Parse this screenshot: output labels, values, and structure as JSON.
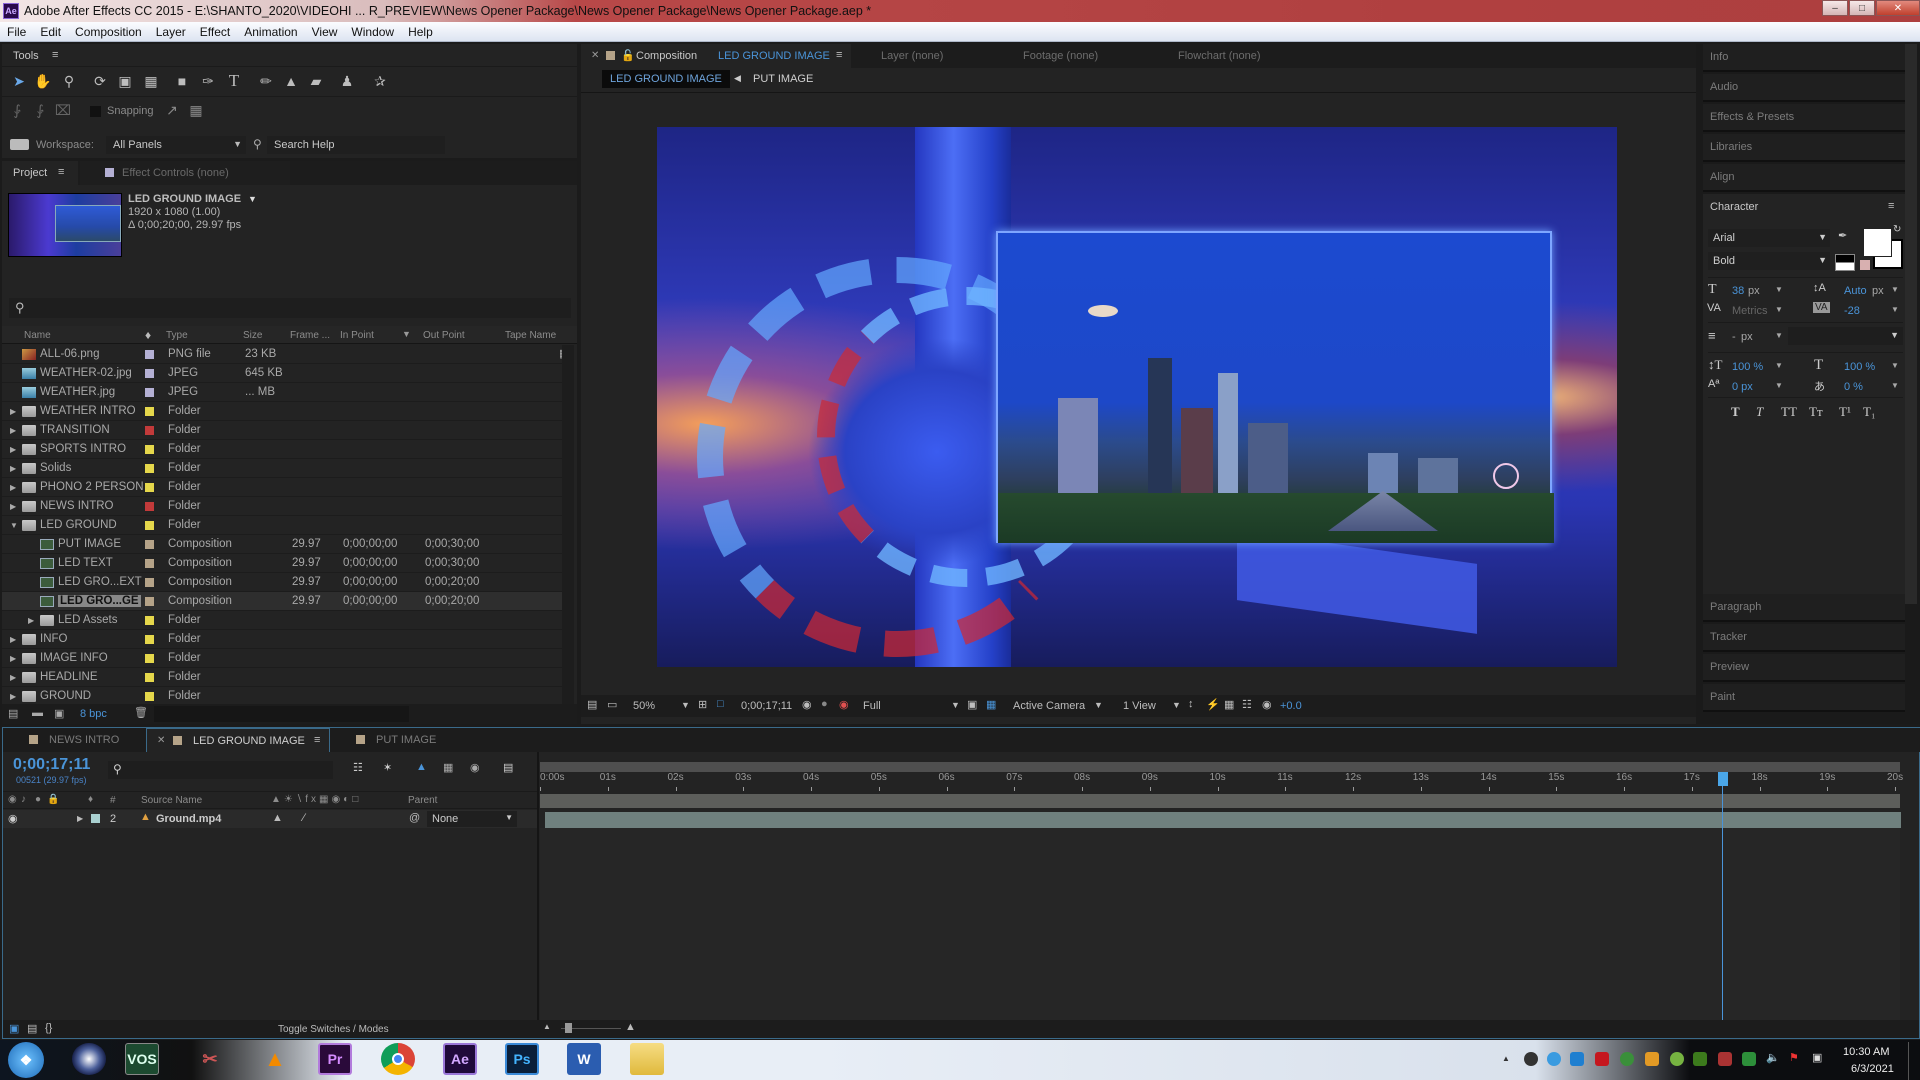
{
  "window": {
    "app_icon": "Ae",
    "title": "Adobe After Effects CC 2015 - E:\\SHANTO_2020\\VIDEOHI ... R_PREVIEW\\News Opener Package\\News Opener Package\\News Opener Package.aep *",
    "controls": [
      "minimize",
      "maximize",
      "close"
    ]
  },
  "menubar": [
    "File",
    "Edit",
    "Composition",
    "Layer",
    "Effect",
    "Animation",
    "View",
    "Window",
    "Help"
  ],
  "tools_panel": {
    "title": "Tools",
    "tools": [
      "selection-tool",
      "hand-tool",
      "zoom-tool",
      "rotation-tool",
      "camera-tool",
      "pan-behind-tool",
      "rectangle-tool",
      "pen-tool",
      "type-tool",
      "brush-tool",
      "clone-stamp-tool",
      "eraser-tool",
      "roto-brush-tool",
      "puppet-pin-tool"
    ],
    "axis_tools": [
      "local-axis",
      "world-axis",
      "view-axis"
    ],
    "snapping_label": "Snapping",
    "workspace_label": "Workspace:",
    "workspace_value": "All Panels",
    "search_help": "Search Help"
  },
  "project_panel": {
    "tab": "Project",
    "tab2": "Effect Controls (none)",
    "selected_item": {
      "name": "LED GROUND IMAGE",
      "dimensions": "1920 x 1080 (1.00)",
      "duration": "Δ 0;00;20;00, 29.97 fps"
    },
    "search_placeholder": "",
    "columns": [
      "Name",
      "Type",
      "Size",
      "Frame ...",
      "In Point",
      "Out Point",
      "Tape Name"
    ],
    "rows": [
      {
        "name": "ALL-06.png",
        "kind": "png",
        "indent": 0,
        "label_color": "#b4b0d4",
        "type": "PNG file",
        "size": "23 KB",
        "frame": "",
        "in": "",
        "out": "",
        "expanded": null
      },
      {
        "name": "WEATHER-02.jpg",
        "kind": "jpg",
        "indent": 0,
        "label_color": "#b4b0d4",
        "type": "JPEG",
        "size": "645 KB",
        "frame": "",
        "in": "",
        "out": "",
        "expanded": null
      },
      {
        "name": "WEATHER.jpg",
        "kind": "jpg",
        "indent": 0,
        "label_color": "#b4b0d4",
        "type": "JPEG",
        "size": "... MB",
        "frame": "",
        "in": "",
        "out": "",
        "expanded": null
      },
      {
        "name": "WEATHER INTRO",
        "kind": "folder",
        "indent": 0,
        "label_color": "#e5d74b",
        "type": "Folder",
        "size": "",
        "frame": "",
        "in": "",
        "out": "",
        "expanded": false
      },
      {
        "name": "TRANSITION",
        "kind": "folder",
        "indent": 0,
        "label_color": "#c23a3a",
        "type": "Folder",
        "size": "",
        "frame": "",
        "in": "",
        "out": "",
        "expanded": false
      },
      {
        "name": "SPORTS INTRO",
        "kind": "folder",
        "indent": 0,
        "label_color": "#e5d74b",
        "type": "Folder",
        "size": "",
        "frame": "",
        "in": "",
        "out": "",
        "expanded": false
      },
      {
        "name": "Solids",
        "kind": "folder",
        "indent": 0,
        "label_color": "#e5d74b",
        "type": "Folder",
        "size": "",
        "frame": "",
        "in": "",
        "out": "",
        "expanded": false
      },
      {
        "name": "PHONO 2 PERSON",
        "kind": "folder",
        "indent": 0,
        "label_color": "#e5d74b",
        "type": "Folder",
        "size": "",
        "frame": "",
        "in": "",
        "out": "",
        "expanded": false
      },
      {
        "name": "NEWS INTRO",
        "kind": "folder",
        "indent": 0,
        "label_color": "#c23a3a",
        "type": "Folder",
        "size": "",
        "frame": "",
        "in": "",
        "out": "",
        "expanded": false
      },
      {
        "name": "LED GROUND",
        "kind": "folder",
        "indent": 0,
        "label_color": "#e5d74b",
        "type": "Folder",
        "size": "",
        "frame": "",
        "in": "",
        "out": "",
        "expanded": true
      },
      {
        "name": "PUT  IMAGE",
        "kind": "comp",
        "indent": 1,
        "label_color": "#b5a388",
        "type": "Composition",
        "size": "",
        "frame": "29.97",
        "in": "0;00;00;00",
        "out": "0;00;30;00",
        "expanded": null
      },
      {
        "name": "LED TEXT",
        "kind": "comp",
        "indent": 1,
        "label_color": "#b5a388",
        "type": "Composition",
        "size": "",
        "frame": "29.97",
        "in": "0;00;00;00",
        "out": "0;00;30;00",
        "expanded": null
      },
      {
        "name": "LED GRO...EXT",
        "kind": "comp",
        "indent": 1,
        "label_color": "#b5a388",
        "type": "Composition",
        "size": "",
        "frame": "29.97",
        "in": "0;00;00;00",
        "out": "0;00;20;00",
        "expanded": null
      },
      {
        "name": "LED GRO...GE",
        "kind": "comp",
        "indent": 1,
        "label_color": "#b5a388",
        "type": "Composition",
        "size": "",
        "frame": "29.97",
        "in": "0;00;00;00",
        "out": "0;00;20;00",
        "expanded": null,
        "selected": true
      },
      {
        "name": "LED Assets",
        "kind": "folder",
        "indent": 1,
        "label_color": "#e5d74b",
        "type": "Folder",
        "size": "",
        "frame": "",
        "in": "",
        "out": "",
        "expanded": false
      },
      {
        "name": "INFO",
        "kind": "folder",
        "indent": 0,
        "label_color": "#e5d74b",
        "type": "Folder",
        "size": "",
        "frame": "",
        "in": "",
        "out": "",
        "expanded": false
      },
      {
        "name": "IMAGE INFO",
        "kind": "folder",
        "indent": 0,
        "label_color": "#e5d74b",
        "type": "Folder",
        "size": "",
        "frame": "",
        "in": "",
        "out": "",
        "expanded": false
      },
      {
        "name": "HEADLINE",
        "kind": "folder",
        "indent": 0,
        "label_color": "#e5d74b",
        "type": "Folder",
        "size": "",
        "frame": "",
        "in": "",
        "out": "",
        "expanded": false
      },
      {
        "name": "GROUND",
        "kind": "folder",
        "indent": 0,
        "label_color": "#e5d74b",
        "type": "Folder",
        "size": "",
        "frame": "",
        "in": "",
        "out": "",
        "expanded": false
      }
    ],
    "footer": {
      "bpc": "8 bpc"
    }
  },
  "composition_panel": {
    "tab_prefix": "Composition",
    "tab_comp": "LED GROUND IMAGE",
    "other_tabs": [
      "Layer (none)",
      "Footage (none)",
      "Flowchart (none)"
    ],
    "breadcrumb": [
      "LED GROUND IMAGE",
      "PUT IMAGE"
    ],
    "viewer_toolbar": {
      "magnification": "50%",
      "timecode": "0;00;17;11",
      "resolution": "Full",
      "camera": "Active Camera",
      "views": "1 View",
      "exposure": "+0.0"
    }
  },
  "right_panels": {
    "collapsed_top": [
      "Info",
      "Audio",
      "Effects & Presets",
      "Libraries",
      "Align"
    ],
    "character": {
      "title": "Character",
      "font": "Arial",
      "style": "Bold",
      "size": "38",
      "size_unit": "px",
      "leading": "Auto",
      "leading_unit": "px",
      "kerning": "Metrics",
      "tracking": "-28",
      "stroke_width": "-",
      "stroke_unit": "px",
      "vscale": "100 %",
      "hscale": "100 %",
      "baseline": "0 px",
      "tsume": "0 %",
      "style_buttons": [
        "T",
        "T",
        "TT",
        "Tт",
        "T¹",
        "T₁"
      ]
    },
    "collapsed_bottom": [
      "Paragraph",
      "Tracker",
      "Preview",
      "Paint"
    ]
  },
  "timeline": {
    "tabs": [
      {
        "label": "NEWS INTRO",
        "active": false
      },
      {
        "label": "LED GROUND IMAGE",
        "active": true
      },
      {
        "label": "PUT  IMAGE",
        "active": false
      }
    ],
    "current_time": "0;00;17;11",
    "frame_info": "00521 (29.97 fps)",
    "columns": {
      "num": "#",
      "source": "Source Name",
      "parent": "Parent"
    },
    "layers": [
      {
        "number": "2",
        "name": "Ground.mp4",
        "parent": "None"
      }
    ],
    "ruler": [
      "0:00s",
      "01s",
      "02s",
      "03s",
      "04s",
      "05s",
      "06s",
      "07s",
      "08s",
      "09s",
      "10s",
      "11s",
      "12s",
      "13s",
      "14s",
      "15s",
      "16s",
      "17s",
      "18s",
      "19s",
      "20s"
    ],
    "duration_seconds": 20,
    "playhead_seconds": 17.37,
    "footer_toggle": "Toggle Switches / Modes"
  },
  "taskbar": {
    "apps": [
      "start",
      "cinema4d",
      "vos",
      "snipping",
      "vlc",
      "Pr",
      "chrome",
      "Ae",
      "Ps",
      "W",
      "explorer"
    ],
    "time": "10:30 AM",
    "date": "6/3/2021"
  }
}
